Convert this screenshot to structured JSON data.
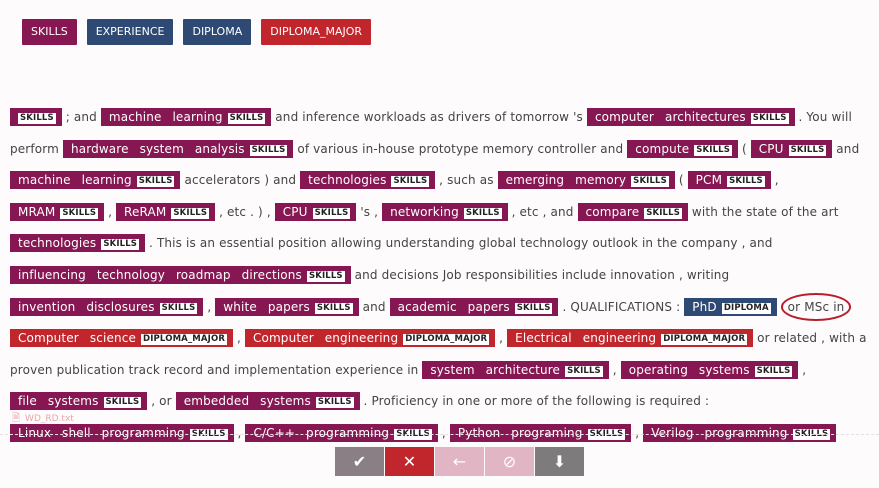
{
  "labels": [
    {
      "text": "SKILLS",
      "color": "#861752"
    },
    {
      "text": "EXPERIENCE",
      "color": "#2e4a74"
    },
    {
      "text": "DIPLOMA",
      "color": "#2e4a74"
    },
    {
      "text": "DIPLOMA_MAJOR",
      "color": "#c0262c"
    }
  ],
  "segments": [
    {
      "t": "e",
      "text": "",
      "label": "SKILLS"
    },
    {
      "t": "t",
      "text": " ; and "
    },
    {
      "t": "e",
      "text": "machine learning",
      "label": "SKILLS"
    },
    {
      "t": "t",
      "text": " and inference workloads as drivers of tomorrow 's "
    },
    {
      "t": "e",
      "text": "computer architectures",
      "label": "SKILLS"
    },
    {
      "t": "t",
      "text": " . You will perform "
    },
    {
      "t": "e",
      "text": "hardware system analysis",
      "label": "SKILLS"
    },
    {
      "t": "t",
      "text": " of various in-house prototype memory controller and "
    },
    {
      "t": "e",
      "text": "compute",
      "label": "SKILLS"
    },
    {
      "t": "t",
      "text": " ( "
    },
    {
      "t": "e",
      "text": "CPU",
      "label": "SKILLS"
    },
    {
      "t": "t",
      "text": " and "
    },
    {
      "t": "e",
      "text": "machine learning",
      "label": "SKILLS"
    },
    {
      "t": "t",
      "text": " accelerators ) and "
    },
    {
      "t": "e",
      "text": "technologies",
      "label": "SKILLS"
    },
    {
      "t": "t",
      "text": " , such as "
    },
    {
      "t": "e",
      "text": "emerging memory",
      "label": "SKILLS"
    },
    {
      "t": "t",
      "text": " ( "
    },
    {
      "t": "e",
      "text": "PCM",
      "label": "SKILLS"
    },
    {
      "t": "t",
      "text": " , "
    },
    {
      "t": "e",
      "text": "MRAM",
      "label": "SKILLS"
    },
    {
      "t": "t",
      "text": " , "
    },
    {
      "t": "e",
      "text": "ReRAM",
      "label": "SKILLS"
    },
    {
      "t": "t",
      "text": " , etc . ) , "
    },
    {
      "t": "e",
      "text": "CPU",
      "label": "SKILLS"
    },
    {
      "t": "t",
      "text": " 's , "
    },
    {
      "t": "e",
      "text": "networking",
      "label": "SKILLS"
    },
    {
      "t": "t",
      "text": " , etc , and "
    },
    {
      "t": "e",
      "text": "compare",
      "label": "SKILLS"
    },
    {
      "t": "t",
      "text": " with the state of the art "
    },
    {
      "t": "e",
      "text": "technologies",
      "label": "SKILLS"
    },
    {
      "t": "t",
      "text": " . This is an essential position allowing understanding global technology outlook in the company , and "
    },
    {
      "t": "e",
      "text": "influencing technology roadmap directions",
      "label": "SKILLS"
    },
    {
      "t": "t",
      "text": " and decisions Job responsibilities include innovation , writing "
    },
    {
      "t": "e",
      "text": "invention disclosures",
      "label": "SKILLS"
    },
    {
      "t": "t",
      "text": " , "
    },
    {
      "t": "e",
      "text": "white papers",
      "label": "SKILLS"
    },
    {
      "t": "t",
      "text": " and "
    },
    {
      "t": "e",
      "text": "academic papers",
      "label": "SKILLS"
    },
    {
      "t": "t",
      "text": " . QUALIFICATIONS : "
    },
    {
      "t": "e",
      "text": "PhD",
      "label": "DIPLOMA"
    },
    {
      "t": "t",
      "text": " "
    },
    {
      "t": "c",
      "text": "or MSc in"
    },
    {
      "t": "t",
      "text": " "
    },
    {
      "t": "e",
      "text": "Computer science",
      "label": "DIPLOMA_MAJOR"
    },
    {
      "t": "t",
      "text": " , "
    },
    {
      "t": "e",
      "text": "Computer engineering",
      "label": "DIPLOMA_MAJOR"
    },
    {
      "t": "t",
      "text": " , "
    },
    {
      "t": "e",
      "text": "Electrical engineering",
      "label": "DIPLOMA_MAJOR"
    },
    {
      "t": "t",
      "text": " or related , with a proven publication track record and implementation experience in "
    },
    {
      "t": "e",
      "text": "system architecture",
      "label": "SKILLS"
    },
    {
      "t": "t",
      "text": " , "
    },
    {
      "t": "e",
      "text": "operating systems",
      "label": "SKILLS"
    },
    {
      "t": "t",
      "text": " , "
    },
    {
      "t": "e",
      "text": "file systems",
      "label": "SKILLS"
    },
    {
      "t": "t",
      "text": " , or "
    },
    {
      "t": "e",
      "text": "embedded systems",
      "label": "SKILLS"
    },
    {
      "t": "t",
      "text": " . Proficiency in one or more of the following is required : "
    },
    {
      "t": "e",
      "text": "Linux shell programming",
      "label": "SKILLS"
    },
    {
      "t": "t",
      "text": " , "
    },
    {
      "t": "e",
      "text": "C/C++ programming",
      "label": "SKILLS"
    },
    {
      "t": "t",
      "text": " , "
    },
    {
      "t": "e",
      "text": "Python programing",
      "label": "SKILLS"
    },
    {
      "t": "t",
      "text": " , "
    },
    {
      "t": "e",
      "text": "Verilog programming",
      "label": "SKILLS"
    }
  ],
  "filename": "WD_RD.txt",
  "actions": [
    {
      "name": "accept-button",
      "glyph": "✔",
      "color": "#8a7f84",
      "icon": "check-icon"
    },
    {
      "name": "reject-button",
      "glyph": "✕",
      "color": "#c0262c",
      "icon": "close-icon"
    },
    {
      "name": "back-button",
      "glyph": "←",
      "color": "#e2b5c4",
      "icon": "arrow-left-icon"
    },
    {
      "name": "skip-button",
      "glyph": "⊘",
      "color": "#e2b5c4",
      "icon": "ban-icon"
    },
    {
      "name": "save-button",
      "glyph": "⬇",
      "color": "#7e7b7d",
      "icon": "download-icon"
    }
  ]
}
